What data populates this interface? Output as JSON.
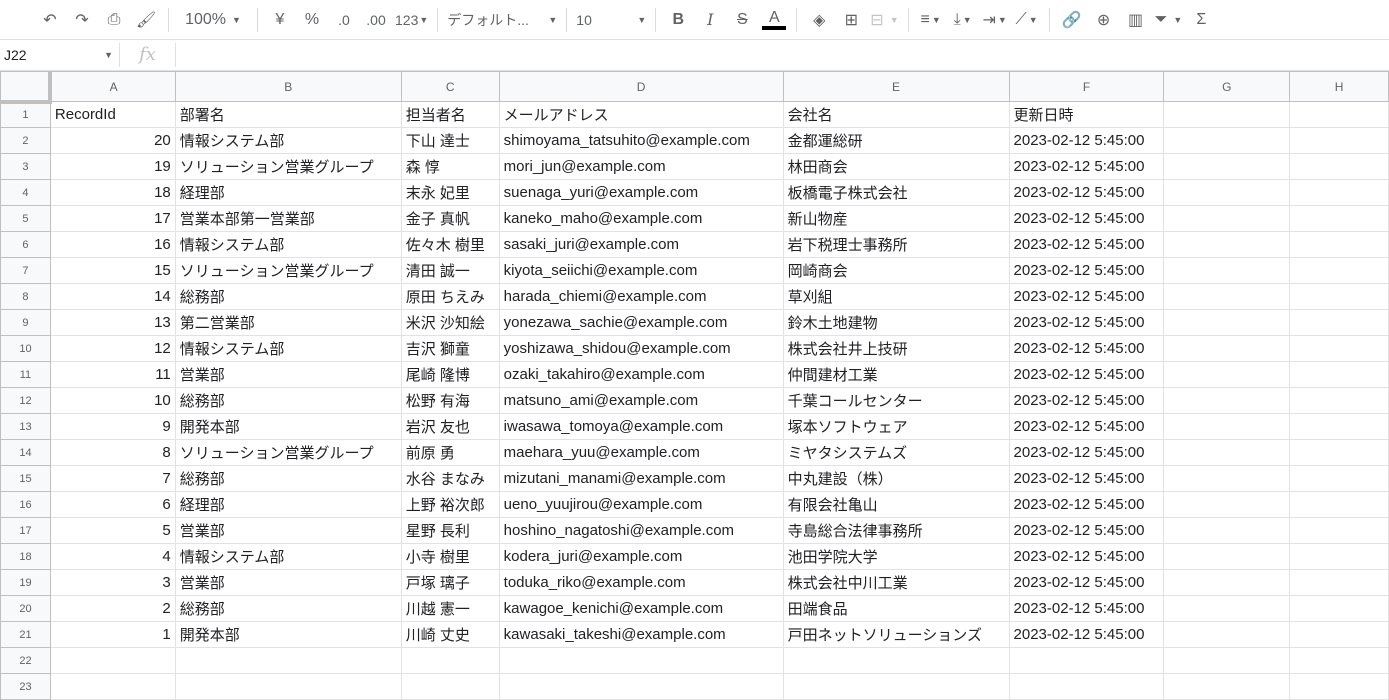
{
  "toolbar": {
    "zoom": "100%",
    "currency": "¥",
    "percent": "%",
    "dec_decrease": ".0",
    "dec_increase": ".00",
    "format_more": "123",
    "font": "デフォルト...",
    "font_size": "10",
    "bold": "B",
    "italic": "I",
    "strike": "S",
    "text_color": "A",
    "sum": "Σ"
  },
  "formula_bar": {
    "cell_ref": "J22",
    "fx": "fx",
    "value": ""
  },
  "columns": [
    "A",
    "B",
    "C",
    "D",
    "E",
    "F",
    "G",
    "H"
  ],
  "header_row": [
    "RecordId",
    "部署名",
    "担当者名",
    "メールアドレス",
    "会社名",
    "更新日時"
  ],
  "rows": [
    [
      "20",
      "情報システム部",
      "下山 達士",
      "shimoyama_tatsuhito@example.com",
      "金都運総研",
      "2023-02-12 5:45:00"
    ],
    [
      "19",
      "ソリューション営業グループ",
      "森 惇",
      "mori_jun@example.com",
      "林田商会",
      "2023-02-12 5:45:00"
    ],
    [
      "18",
      "経理部",
      "末永 妃里",
      "suenaga_yuri@example.com",
      "板橋電子株式会社",
      "2023-02-12 5:45:00"
    ],
    [
      "17",
      "営業本部第一営業部",
      "金子 真帆",
      "kaneko_maho@example.com",
      "新山物産",
      "2023-02-12 5:45:00"
    ],
    [
      "16",
      "情報システム部",
      "佐々木 樹里",
      "sasaki_juri@example.com",
      "岩下税理士事務所",
      "2023-02-12 5:45:00"
    ],
    [
      "15",
      "ソリューション営業グループ",
      "清田 誠一",
      "kiyota_seiichi@example.com",
      "岡崎商会",
      "2023-02-12 5:45:00"
    ],
    [
      "14",
      "総務部",
      "原田 ちえみ",
      "harada_chiemi@example.com",
      "草刈組",
      "2023-02-12 5:45:00"
    ],
    [
      "13",
      "第二営業部",
      "米沢 沙知絵",
      "yonezawa_sachie@example.com",
      "鈴木土地建物",
      "2023-02-12 5:45:00"
    ],
    [
      "12",
      "情報システム部",
      "吉沢 獅童",
      "yoshizawa_shidou@example.com",
      "株式会社井上技研",
      "2023-02-12 5:45:00"
    ],
    [
      "11",
      "営業部",
      "尾崎 隆博",
      "ozaki_takahiro@example.com",
      "仲間建材工業",
      "2023-02-12 5:45:00"
    ],
    [
      "10",
      "総務部",
      "松野 有海",
      "matsuno_ami@example.com",
      "千葉コールセンター",
      "2023-02-12 5:45:00"
    ],
    [
      "9",
      "開発本部",
      "岩沢 友也",
      "iwasawa_tomoya@example.com",
      "塚本ソフトウェア",
      "2023-02-12 5:45:00"
    ],
    [
      "8",
      "ソリューション営業グループ",
      "前原 勇",
      "maehara_yuu@example.com",
      "ミヤタシステムズ",
      "2023-02-12 5:45:00"
    ],
    [
      "7",
      "総務部",
      "水谷 まなみ",
      "mizutani_manami@example.com",
      "中丸建設（株）",
      "2023-02-12 5:45:00"
    ],
    [
      "6",
      "経理部",
      "上野 裕次郎",
      "ueno_yuujirou@example.com",
      "有限会社亀山",
      "2023-02-12 5:45:00"
    ],
    [
      "5",
      "営業部",
      "星野 長利",
      "hoshino_nagatoshi@example.com",
      "寺島総合法律事務所",
      "2023-02-12 5:45:00"
    ],
    [
      "4",
      "情報システム部",
      "小寺 樹里",
      "kodera_juri@example.com",
      "池田学院大学",
      "2023-02-12 5:45:00"
    ],
    [
      "3",
      "営業部",
      "戸塚 璃子",
      "toduka_riko@example.com",
      "株式会社中川工業",
      "2023-02-12 5:45:00"
    ],
    [
      "2",
      "総務部",
      "川越 憲一",
      "kawagoe_kenichi@example.com",
      "田端食品",
      "2023-02-12 5:45:00"
    ],
    [
      "1",
      "開発本部",
      "川崎 丈史",
      "kawasaki_takeshi@example.com",
      "戸田ネットソリューションズ",
      "2023-02-12 5:45:00"
    ]
  ],
  "row_numbers": [
    "1",
    "2",
    "3",
    "4",
    "5",
    "6",
    "7",
    "8",
    "9",
    "10",
    "11",
    "12",
    "13",
    "14",
    "15",
    "16",
    "17",
    "18",
    "19",
    "20",
    "21",
    "22",
    "23"
  ]
}
